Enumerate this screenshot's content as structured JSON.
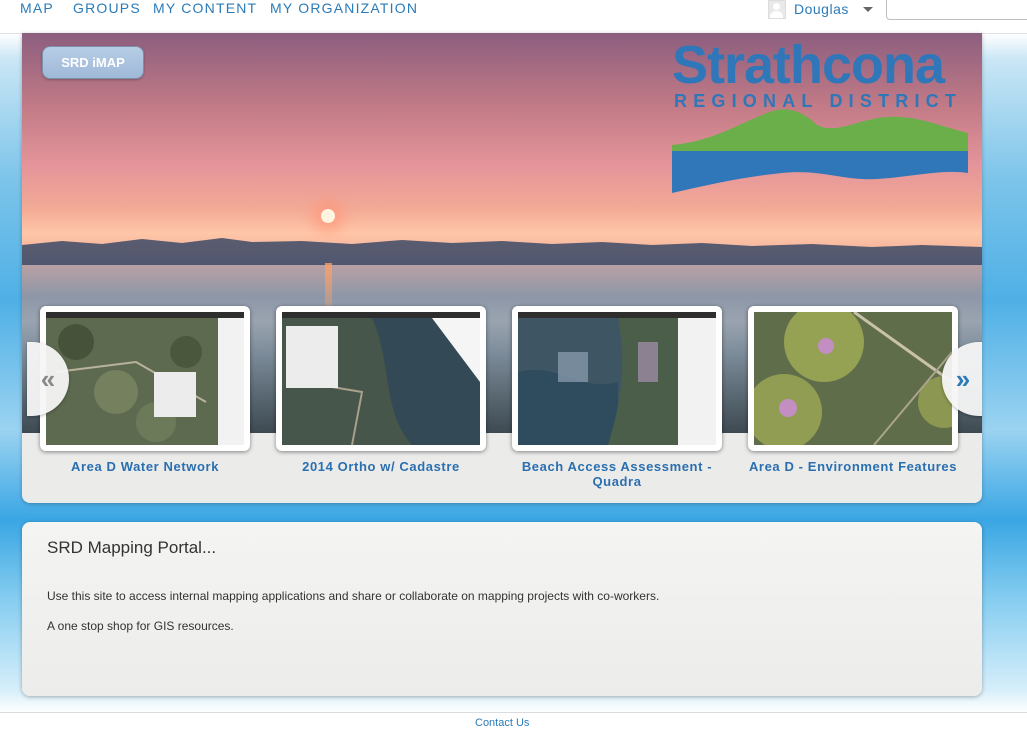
{
  "nav": {
    "items": [
      "MAP",
      "GROUPS",
      "MY CONTENT",
      "MY ORGANIZATION"
    ],
    "user": "Douglas",
    "search_value": ""
  },
  "banner": {
    "app_button": "SRD iMAP",
    "logo_title": "Strathcona",
    "logo_subtitle": "REGIONAL DISTRICT"
  },
  "gallery": {
    "items": [
      {
        "title": "Area D Water Network"
      },
      {
        "title": "2014 Ortho w/ Cadastre"
      },
      {
        "title": "Beach Access Assessment - Quadra"
      },
      {
        "title": "Area D - Environment Features"
      }
    ],
    "prev_icon": "double-chevron-left",
    "next_icon": "double-chevron-right"
  },
  "info": {
    "title": "SRD Mapping Portal...",
    "paragraphs": [
      "Use this site to access internal mapping applications and share or collaborate on mapping projects with co-workers.",
      "A one stop shop for GIS resources."
    ]
  },
  "footer": {
    "contact": "Contact Us"
  },
  "colors": {
    "link": "#2a7bb8",
    "logo_blue": "#2f77b9",
    "logo_green": "#6aaf4a"
  }
}
